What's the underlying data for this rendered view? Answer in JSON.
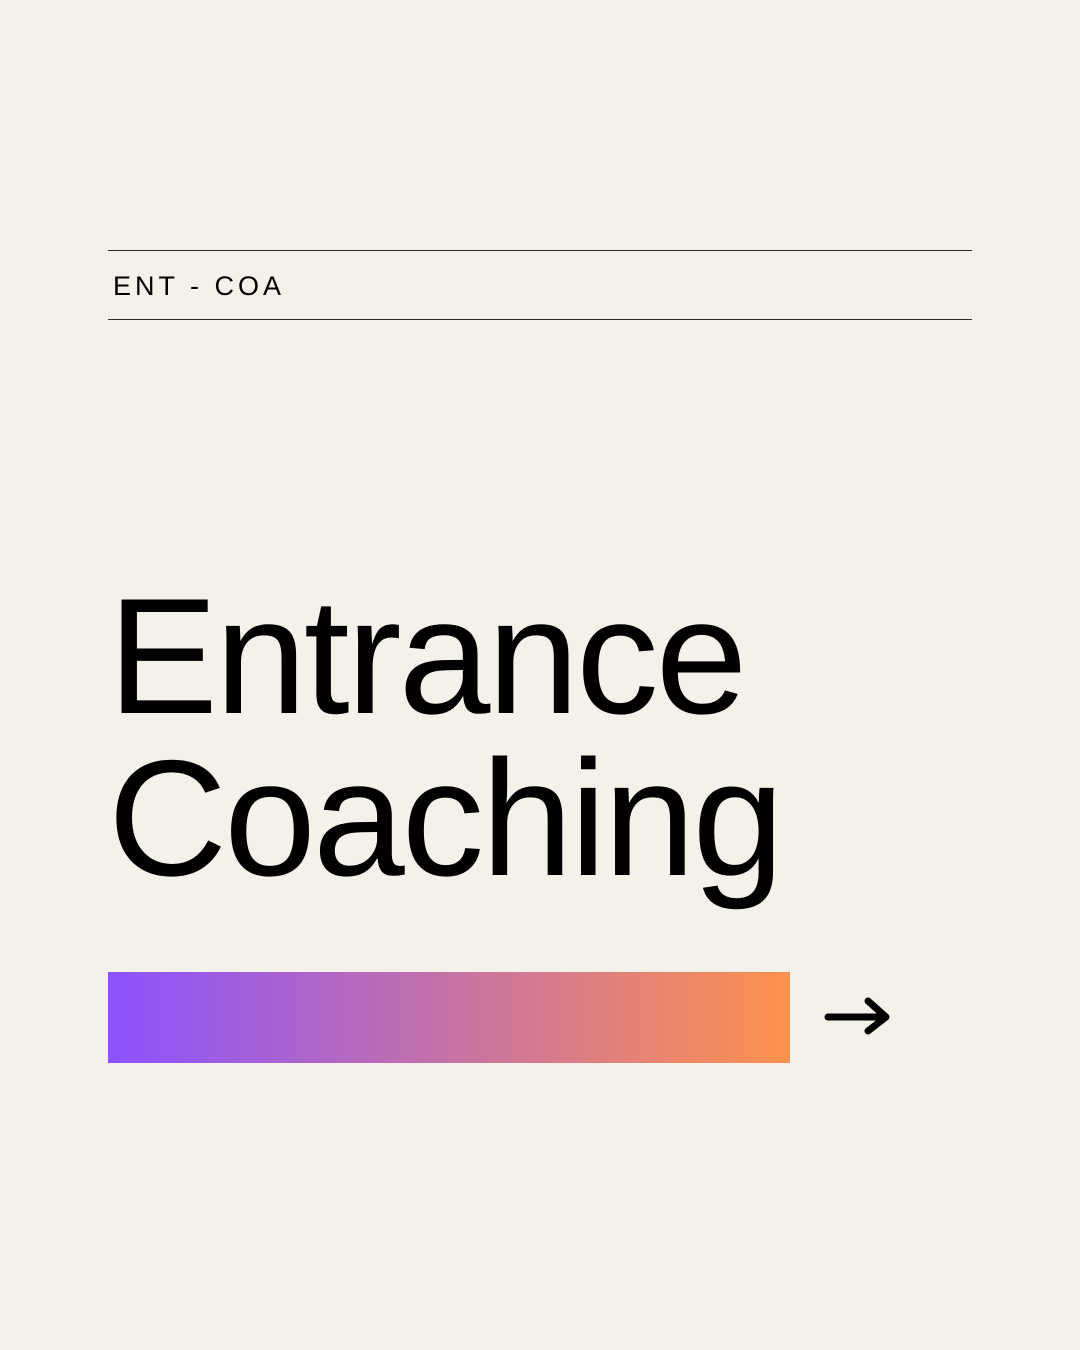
{
  "header": {
    "code": "ENT - COA"
  },
  "title": {
    "line1": "Entrance",
    "line2": "Coaching"
  },
  "colors": {
    "background": "#f4f1ea",
    "gradient_start": "#8b52ff",
    "gradient_end": "#ff914d",
    "text": "#000000"
  },
  "icons": {
    "next": "arrow-right-icon"
  }
}
